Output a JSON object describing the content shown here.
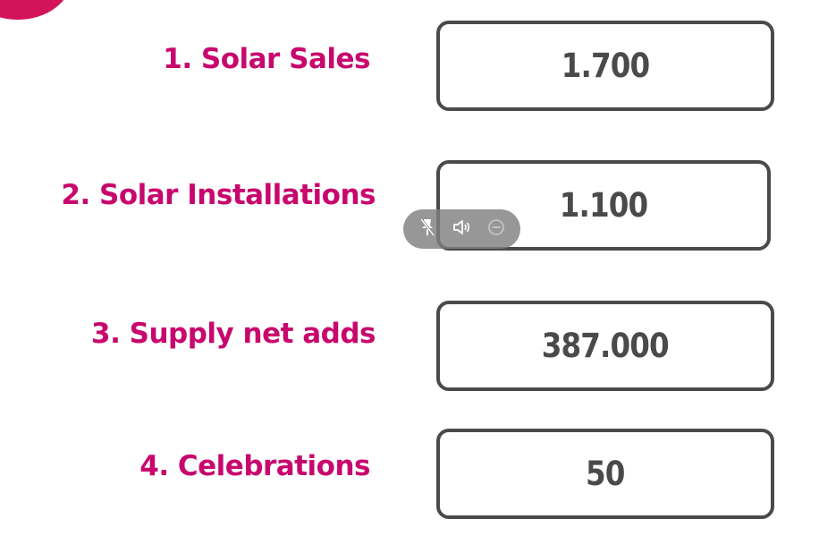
{
  "metrics": [
    {
      "label": "1. Solar Sales",
      "value": "1.700"
    },
    {
      "label": "2. Solar Installations",
      "value": "1.100"
    },
    {
      "label": "3. Supply net adds",
      "value": "387.000"
    },
    {
      "label": "4. Celebrations",
      "value": "50"
    }
  ],
  "media_toolbar": {
    "icons": [
      "unpin-icon",
      "speaker-icon",
      "minimize-icon"
    ]
  },
  "colors": {
    "label": "#c8076e",
    "value": "#4a4a4a",
    "box_border": "#4a4a4a",
    "accent_blob": "#d4145a",
    "toolbar_bg": "#808080"
  }
}
